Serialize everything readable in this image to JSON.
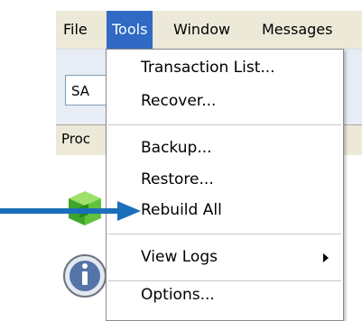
{
  "menubar": {
    "items": [
      "File",
      "Tools",
      "Window",
      "Messages"
    ],
    "active": "Tools"
  },
  "toolbar": {
    "combo_value": "SA"
  },
  "list": {
    "header": "Proc"
  },
  "tools_menu": {
    "items": [
      {
        "label": "Transaction List..."
      },
      {
        "label": "Recover..."
      },
      {
        "label": "Backup..."
      },
      {
        "label": "Restore..."
      },
      {
        "label": "Rebuild All"
      },
      {
        "label": "View Logs",
        "submenu": true
      },
      {
        "label": "Options..."
      }
    ]
  },
  "colors": {
    "menubar_bg": "#ece9d8",
    "active_highlight": "#316ac5",
    "pointer_arrow": "#1b6fba"
  },
  "icons": [
    "green-cube-icon",
    "info-icon",
    "submenu-arrow-icon",
    "pointer-arrow-icon"
  ]
}
